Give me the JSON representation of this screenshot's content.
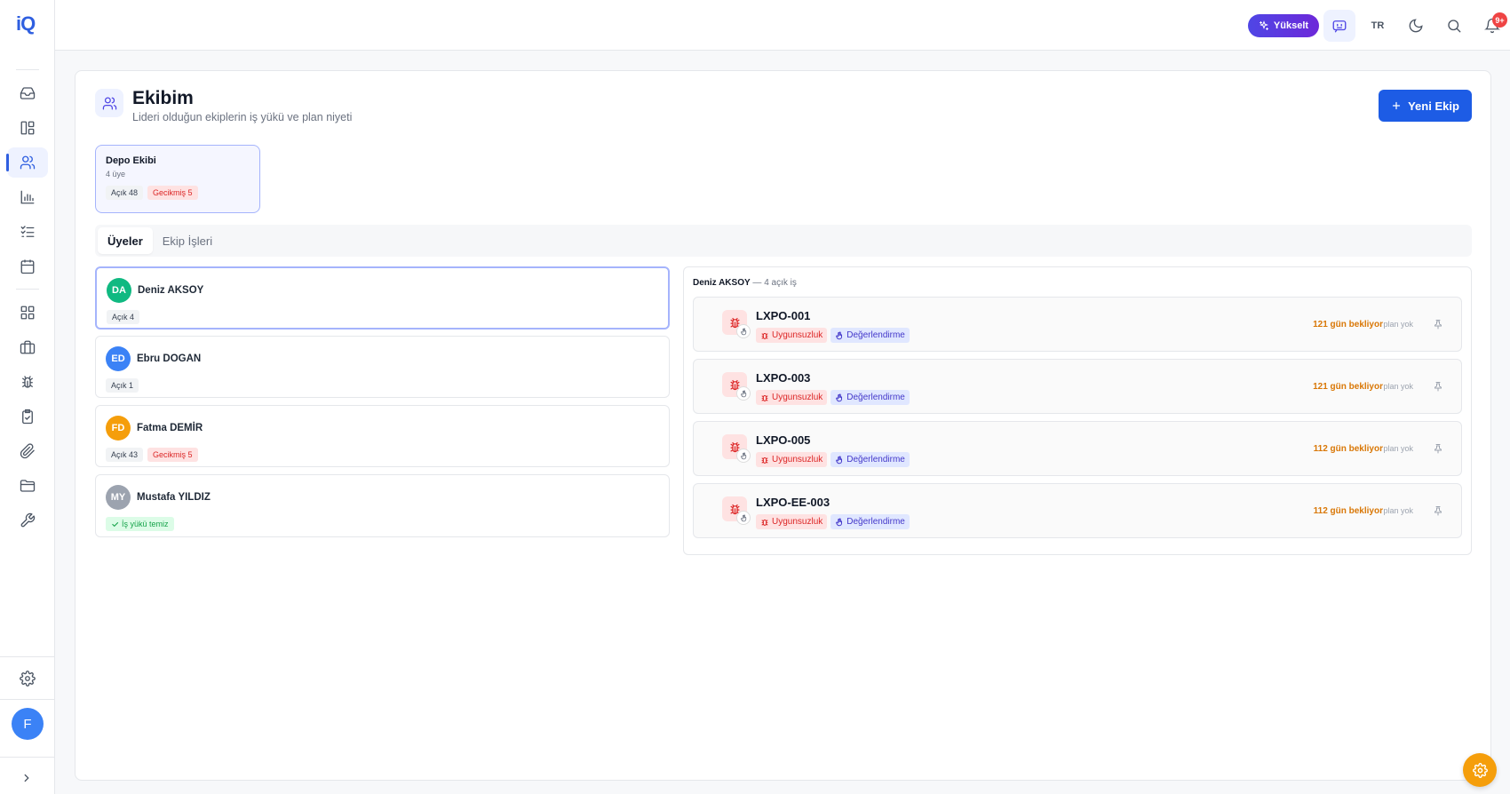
{
  "app": {
    "logo_text": "iQ"
  },
  "sidebar": {
    "items": [
      {
        "icon": "inbox-icon"
      },
      {
        "icon": "layout-icon"
      },
      {
        "icon": "users-icon"
      },
      {
        "icon": "bar-chart-icon"
      },
      {
        "icon": "list-check-icon"
      },
      {
        "icon": "calendar-icon"
      },
      {
        "icon": "grid-icon"
      },
      {
        "icon": "briefcase-icon"
      },
      {
        "icon": "bug-icon"
      },
      {
        "icon": "clipboard-check-icon"
      },
      {
        "icon": "paperclip-icon"
      },
      {
        "icon": "folder-icon"
      },
      {
        "icon": "wrench-icon"
      }
    ],
    "settings_icon": "gear-icon",
    "avatar_initial": "F",
    "expand_icon": "chevron-right-icon"
  },
  "topbar": {
    "upgrade_label": "Yükselt",
    "lang": "TR",
    "notif_count": "9+"
  },
  "page": {
    "title": "Ekibim",
    "subtitle": "Lideri olduğun ekiplerin iş yükü ve plan niyeti",
    "new_button": "Yeni Ekip"
  },
  "team": {
    "name": "Depo Ekibi",
    "members": "4 üye",
    "open": "Açık 48",
    "overdue": "Gecikmiş 5"
  },
  "tabs": [
    {
      "label": "Üyeler",
      "active": true
    },
    {
      "label": "Ekip İşleri",
      "active": false
    }
  ],
  "members": [
    {
      "initials": "DA",
      "name": "Deniz AKSOY",
      "color": "#10b981",
      "open": "Açık 4",
      "overdue": ""
    },
    {
      "initials": "ED",
      "name": "Ebru DOGAN",
      "color": "#3b82f6",
      "open": "Açık 1",
      "overdue": ""
    },
    {
      "initials": "FD",
      "name": "Fatma DEMİR",
      "color": "#f59e0b",
      "open": "Açık 43",
      "overdue": "Gecikmiş 5"
    },
    {
      "initials": "MY",
      "name": "Mustafa YILDIZ",
      "color": "#9ca3af",
      "status": "İş yükü temiz"
    }
  ],
  "detail": {
    "name": "Deniz AKSOY",
    "count": "— 4 açık iş",
    "issues": [
      {
        "code": "LXPO-001",
        "type": "Uygunsuzluk",
        "stage": "Değerlendirme",
        "wait": "121 gün bekliyor",
        "plan": "plan yok"
      },
      {
        "code": "LXPO-003",
        "type": "Uygunsuzluk",
        "stage": "Değerlendirme",
        "wait": "121 gün bekliyor",
        "plan": "plan yok"
      },
      {
        "code": "LXPO-005",
        "type": "Uygunsuzluk",
        "stage": "Değerlendirme",
        "wait": "112 gün bekliyor",
        "plan": "plan yok"
      },
      {
        "code": "LXPO-EE-003",
        "type": "Uygunsuzluk",
        "stage": "Değerlendirme",
        "wait": "112 gün bekliyor",
        "plan": "plan yok"
      }
    ]
  },
  "colors": {
    "primary": "#1d5ce5",
    "accent": "#4f46e5",
    "danger": "#dc2626",
    "warning": "#d97706",
    "success": "#16a34a"
  }
}
